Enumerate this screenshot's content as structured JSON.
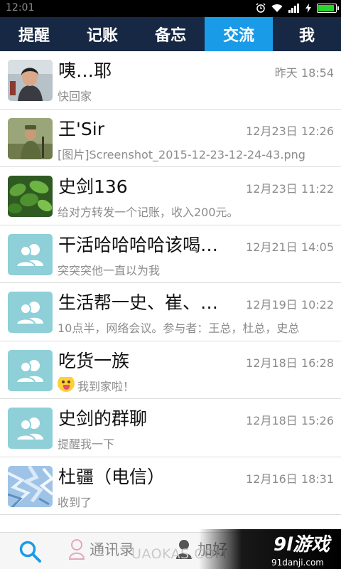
{
  "status_bar": {
    "time": "12:01"
  },
  "tabs": [
    {
      "label": "提醒",
      "active": false
    },
    {
      "label": "记账",
      "active": false
    },
    {
      "label": "备忘",
      "active": false
    },
    {
      "label": "交流",
      "active": true
    },
    {
      "label": "我",
      "active": false
    }
  ],
  "conversations": [
    {
      "name": "咦…耶",
      "time": "昨天 18:54",
      "preview": "快回家",
      "avatar": "photo-woman"
    },
    {
      "name": "王'Sir",
      "time": "12月23日 12:26",
      "preview": "[图片]Screenshot_2015-12-23-12-24-43.png",
      "avatar": "photo-man-outdoor"
    },
    {
      "name": "史剑136",
      "time": "12月23日 11:22",
      "preview": "给对方转发一个记账，收入200元。",
      "avatar": "photo-green-plants"
    },
    {
      "name": "干活哈哈哈哈该喝…",
      "time": "12月21日 14:05",
      "preview": "突突突他一直以为我",
      "avatar": "group-icon"
    },
    {
      "name": "生活帮一史、崔、…",
      "time": "12月19日 10:22",
      "preview": "10点半，网络会议。参与者：王总，杜总，史总",
      "avatar": "group-icon"
    },
    {
      "name": "吃货一族",
      "time": "12月18日 16:28",
      "preview": "我到家啦！",
      "avatar": "group-icon",
      "emoji": "tongue-out-emoji"
    },
    {
      "name": "史剑的群聊",
      "time": "12月18日 15:26",
      "preview": "提醒我一下",
      "avatar": "group-icon"
    },
    {
      "name": "杜疆（电信）",
      "time": "12月16日 18:31",
      "preview": "收到了",
      "avatar": "photo-frost-pattern"
    }
  ],
  "bottom_bar": {
    "search_icon": "search-icon",
    "contacts_label": "通讯录",
    "add_friend_label": "加好"
  },
  "watermark": {
    "main": "9l游戏",
    "sub": "91danji.com",
    "url_fragment": "UAOKAS.COM"
  },
  "colors": {
    "tab_bg": "#172844",
    "tab_active": "#1a9be8",
    "group_avatar": "#8ecfd8",
    "search_blue": "#1a9be8"
  }
}
